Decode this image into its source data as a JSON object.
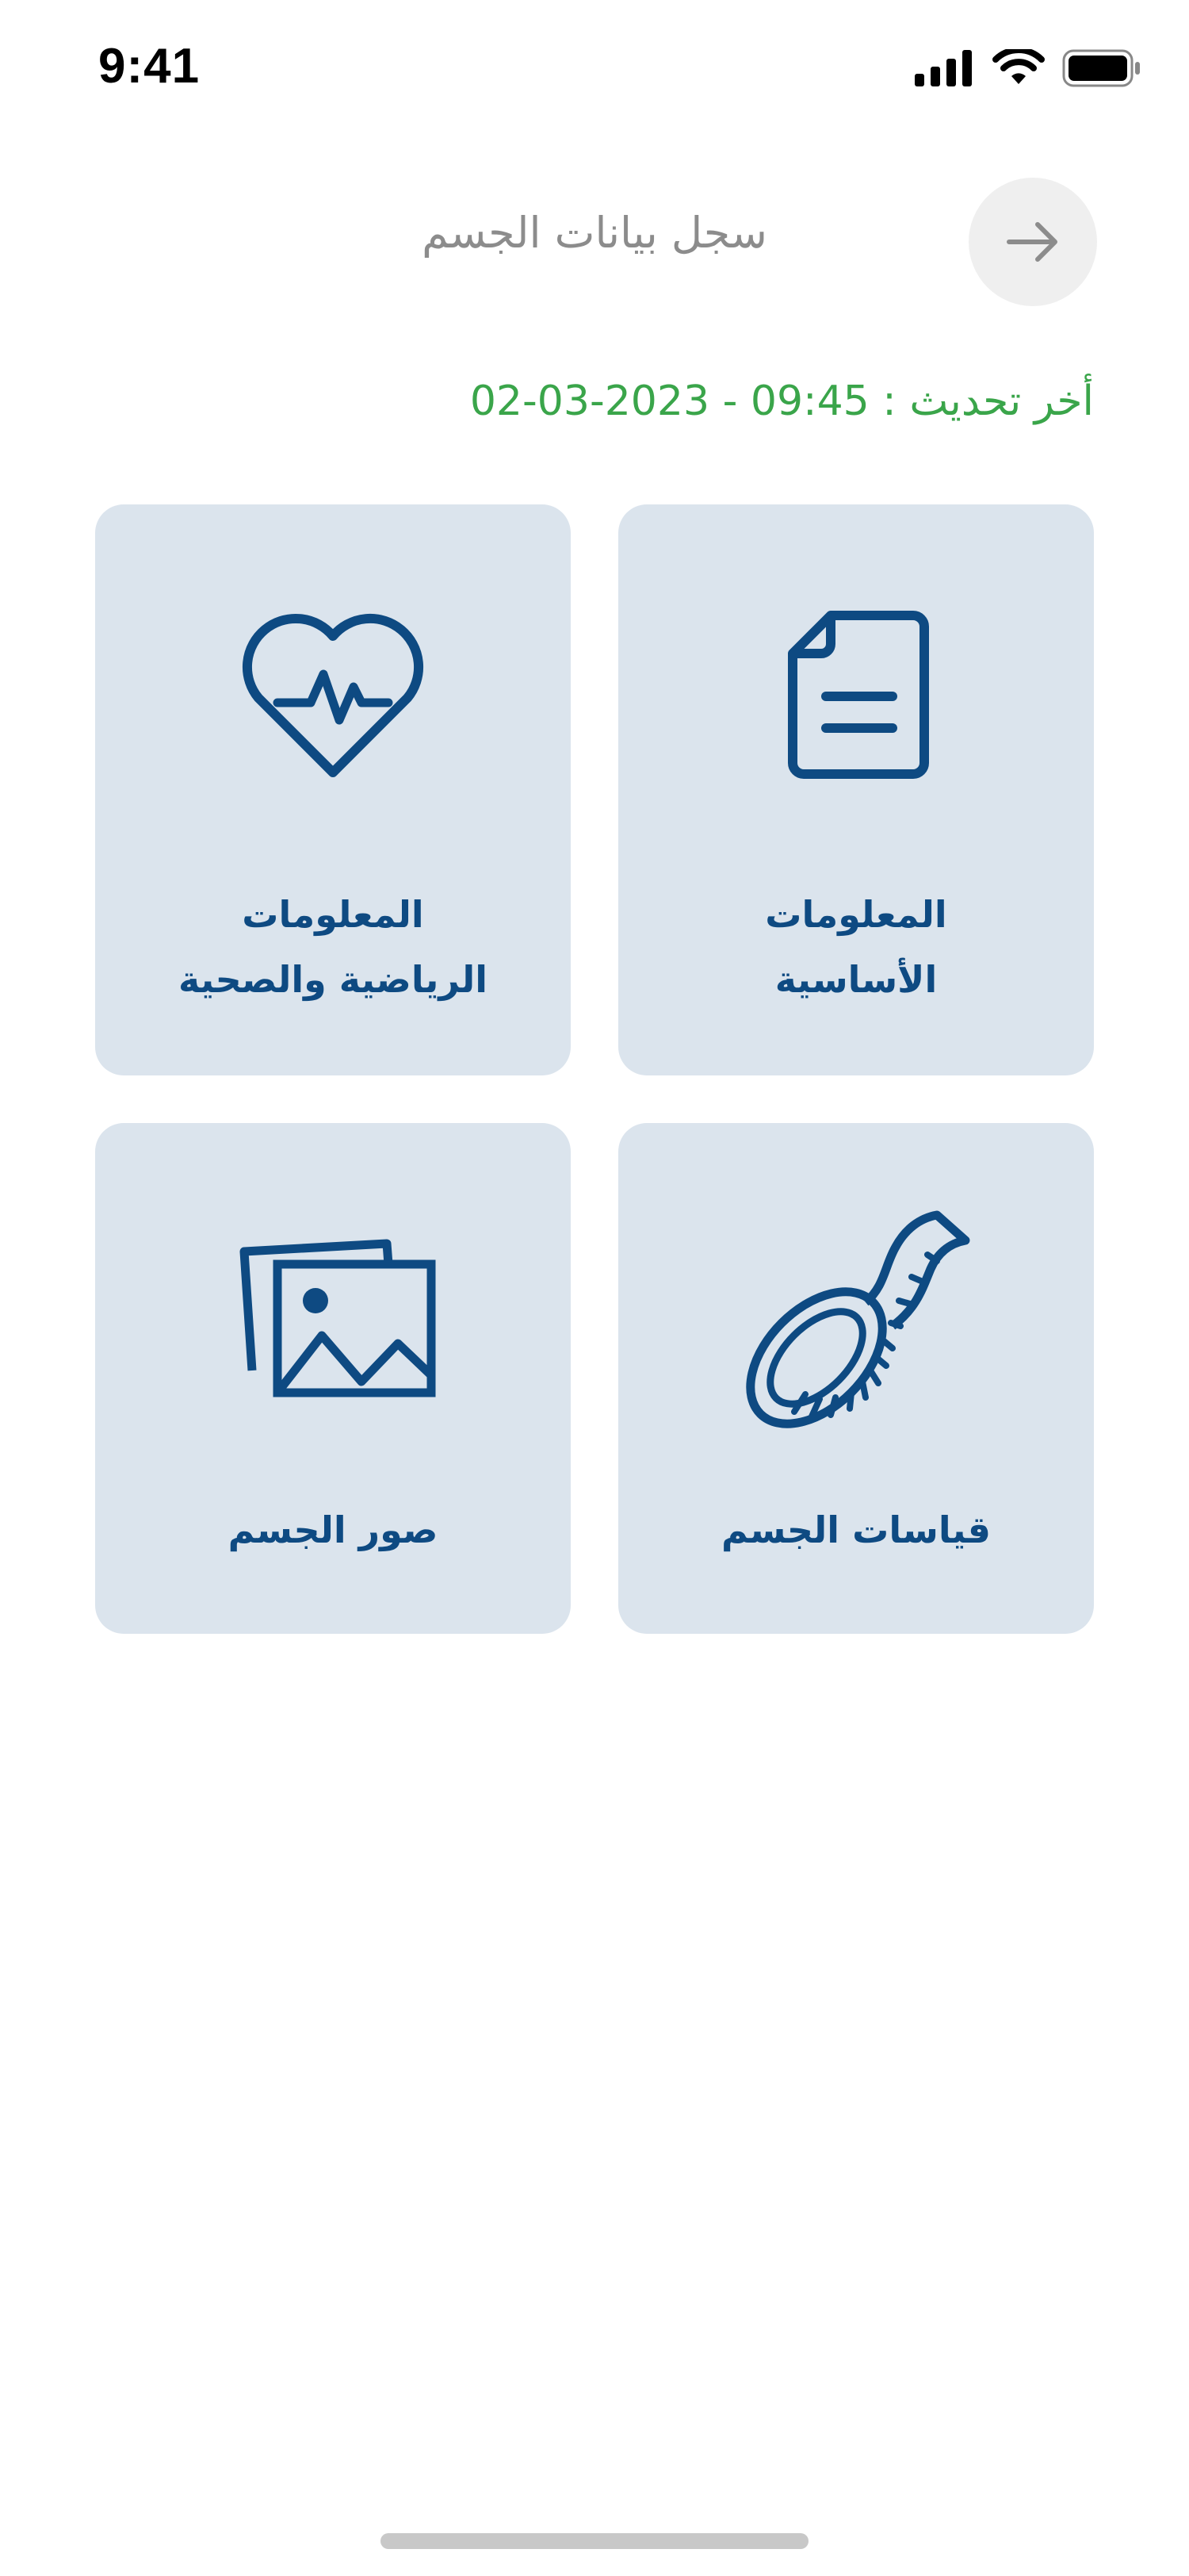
{
  "status_bar": {
    "time": "9:41"
  },
  "header": {
    "title": "سجل بيانات الجسم",
    "back_icon": "arrow-right-icon"
  },
  "last_update": "أخر تحديث : 09:45 - 2023-03-02",
  "colors": {
    "accent_green": "#3aa54a",
    "primary_blue": "#0e4a82",
    "card_bg": "#dbe4ed",
    "title_gray": "#8c8c8c"
  },
  "cards": [
    {
      "label_line1": "المعلومات",
      "label_line2": "الأساسية",
      "icon": "document-icon"
    },
    {
      "label_line1": "المعلومات",
      "label_line2": "الرياضية والصحية",
      "icon": "heart-pulse-icon"
    },
    {
      "label_line1": "قياسات الجسم",
      "label_line2": "",
      "icon": "measuring-tape-icon"
    },
    {
      "label_line1": "صور الجسم",
      "label_line2": "",
      "icon": "images-icon"
    }
  ]
}
